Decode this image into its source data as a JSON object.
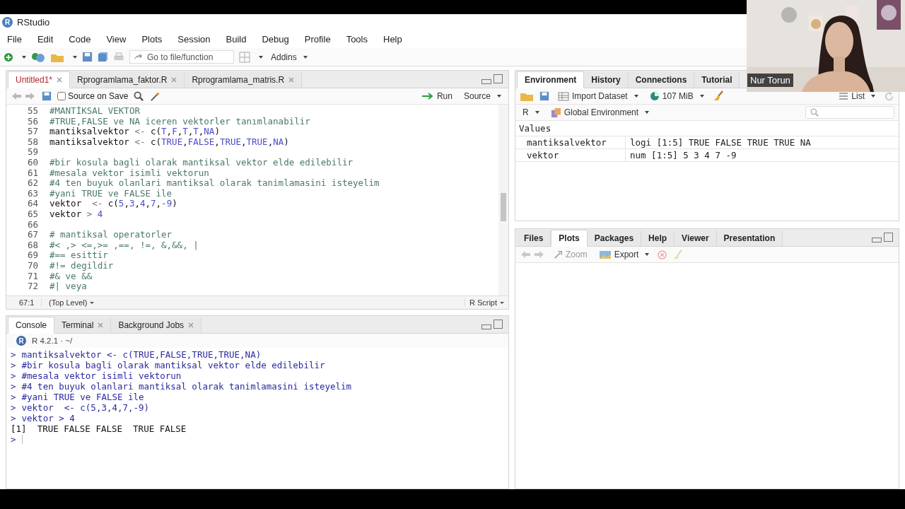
{
  "window": {
    "title": "RStudio",
    "logo": "R"
  },
  "menu": [
    "File",
    "Edit",
    "Code",
    "View",
    "Plots",
    "Session",
    "Build",
    "Debug",
    "Profile",
    "Tools",
    "Help"
  ],
  "toolbar": {
    "goto_placeholder": "Go to file/function",
    "addins": "Addins"
  },
  "source": {
    "tabs": [
      {
        "label": "Untitled1*",
        "selected": true,
        "modified": true
      },
      {
        "label": "Rprogramlama_faktor.R",
        "selected": false,
        "modified": false
      },
      {
        "label": "Rprogramlama_matris.R",
        "selected": false,
        "modified": false
      }
    ],
    "source_on_save": {
      "label": "Source on Save",
      "checked": false
    },
    "run": "Run",
    "source_button": "Source",
    "lines": [
      {
        "number": "55",
        "segments": [
          {
            "kind": "comment",
            "text": "#MANTİKSAL VEKTOR"
          }
        ]
      },
      {
        "number": "56",
        "segments": [
          {
            "kind": "comment",
            "text": "#TRUE,FALSE ve NA iceren vektorler tanımlanabilir"
          }
        ]
      },
      {
        "number": "57",
        "segments": [
          {
            "kind": "code",
            "text": "mantiksalvektor "
          },
          {
            "kind": "op",
            "text": "<-"
          },
          {
            "kind": "code",
            "text": " c("
          },
          {
            "kind": "const",
            "text": "T"
          },
          {
            "kind": "code",
            "text": ","
          },
          {
            "kind": "const",
            "text": "F"
          },
          {
            "kind": "code",
            "text": ","
          },
          {
            "kind": "const",
            "text": "T"
          },
          {
            "kind": "code",
            "text": ","
          },
          {
            "kind": "const",
            "text": "T"
          },
          {
            "kind": "code",
            "text": ","
          },
          {
            "kind": "const",
            "text": "NA"
          },
          {
            "kind": "code",
            "text": ")"
          }
        ]
      },
      {
        "number": "58",
        "segments": [
          {
            "kind": "code",
            "text": "mantiksalvektor "
          },
          {
            "kind": "op",
            "text": "<-"
          },
          {
            "kind": "code",
            "text": " c("
          },
          {
            "kind": "const",
            "text": "TRUE"
          },
          {
            "kind": "code",
            "text": ","
          },
          {
            "kind": "const",
            "text": "FALSE"
          },
          {
            "kind": "code",
            "text": ","
          },
          {
            "kind": "const",
            "text": "TRUE"
          },
          {
            "kind": "code",
            "text": ","
          },
          {
            "kind": "const",
            "text": "TRUE"
          },
          {
            "kind": "code",
            "text": ","
          },
          {
            "kind": "const",
            "text": "NA"
          },
          {
            "kind": "code",
            "text": ")"
          }
        ]
      },
      {
        "number": "59"
      },
      {
        "number": "60",
        "segments": [
          {
            "kind": "comment",
            "text": "#bir kosula bagli olarak mantiksal vektor elde edilebilir"
          }
        ]
      },
      {
        "number": "61",
        "segments": [
          {
            "kind": "comment",
            "text": "#mesala vektor isimli vektorun"
          }
        ]
      },
      {
        "number": "62",
        "segments": [
          {
            "kind": "comment",
            "text": "#4 ten buyuk olanlari mantiksal olarak tanimlamasini isteyelim"
          }
        ]
      },
      {
        "number": "63",
        "segments": [
          {
            "kind": "comment",
            "text": "#yani TRUE ve FALSE ile"
          }
        ]
      },
      {
        "number": "64",
        "segments": [
          {
            "kind": "code",
            "text": "vektor  "
          },
          {
            "kind": "op",
            "text": "<-"
          },
          {
            "kind": "code",
            "text": " c("
          },
          {
            "kind": "const",
            "text": "5"
          },
          {
            "kind": "code",
            "text": ","
          },
          {
            "kind": "const",
            "text": "3"
          },
          {
            "kind": "code",
            "text": ","
          },
          {
            "kind": "const",
            "text": "4"
          },
          {
            "kind": "code",
            "text": ","
          },
          {
            "kind": "const",
            "text": "7"
          },
          {
            "kind": "code",
            "text": ","
          },
          {
            "kind": "const",
            "text": "-9"
          },
          {
            "kind": "code",
            "text": ")"
          }
        ]
      },
      {
        "number": "65",
        "segments": [
          {
            "kind": "code",
            "text": "vektor "
          },
          {
            "kind": "op",
            "text": "> "
          },
          {
            "kind": "const",
            "text": "4"
          }
        ]
      },
      {
        "number": "66"
      },
      {
        "number": "67",
        "segments": [
          {
            "kind": "comment",
            "text": "# mantiksal operatorler"
          }
        ]
      },
      {
        "number": "68",
        "segments": [
          {
            "kind": "comment",
            "text": "#< ,> <=,>= ,==, !=, &,&&, |"
          }
        ]
      },
      {
        "number": "69",
        "segments": [
          {
            "kind": "comment",
            "text": "#== esittir"
          }
        ]
      },
      {
        "number": "70",
        "segments": [
          {
            "kind": "comment",
            "text": "#!= degildir"
          }
        ]
      },
      {
        "number": "71",
        "segments": [
          {
            "kind": "comment",
            "text": "#& ve &&"
          }
        ]
      },
      {
        "number": "72",
        "segments": [
          {
            "kind": "comment",
            "text": "#| veya"
          }
        ]
      }
    ],
    "status": {
      "position": "67:1",
      "scope": "(Top Level)",
      "file_type": "R Script"
    }
  },
  "console": {
    "tabs": [
      {
        "label": "Console",
        "selected": true,
        "closable": false
      },
      {
        "label": "Terminal",
        "selected": false,
        "closable": true
      },
      {
        "label": "Background Jobs",
        "selected": false,
        "closable": true
      }
    ],
    "logo": "R",
    "version": "R 4.2.1 · ~/",
    "lines": [
      {
        "kind": "input",
        "prompt": ">",
        "text": "mantiksalvektor <- c(TRUE,FALSE,TRUE,TRUE,NA)"
      },
      {
        "kind": "input",
        "prompt": ">",
        "text": "#bir kosula bagli olarak mantiksal vektor elde edilebilir"
      },
      {
        "kind": "input",
        "prompt": ">",
        "text": "#mesala vektor isimli vektorun"
      },
      {
        "kind": "input",
        "prompt": ">",
        "text": "#4 ten buyuk olanlari mantiksal olarak tanimlamasini isteyelim"
      },
      {
        "kind": "input",
        "prompt": ">",
        "text": "#yani TRUE ve FALSE ile"
      },
      {
        "kind": "input",
        "prompt": ">",
        "text": "vektor  <- c(5,3,4,7,-9)"
      },
      {
        "kind": "input",
        "prompt": ">",
        "text": "vektor > 4"
      },
      {
        "kind": "output",
        "text": "[1]  TRUE FALSE FALSE  TRUE FALSE"
      }
    ],
    "prompt": ">"
  },
  "environment": {
    "tabs": [
      {
        "label": "Environment",
        "selected": true
      },
      {
        "label": "History",
        "selected": false
      },
      {
        "label": "Connections",
        "selected": false
      },
      {
        "label": "Tutorial",
        "selected": false
      }
    ],
    "import": "Import Dataset",
    "memory": "107 MiB",
    "view": "List",
    "language": "R",
    "scope": "Global Environment",
    "section": "Values",
    "rows": [
      {
        "name": "mantiksalvektor",
        "value": "logi [1:5] TRUE FALSE TRUE TRUE NA"
      },
      {
        "name": "vektor",
        "value": "num [1:5] 5 3 4 7 -9"
      }
    ]
  },
  "files": {
    "tabs": [
      {
        "label": "Files",
        "selected": false
      },
      {
        "label": "Plots",
        "selected": true
      },
      {
        "label": "Packages",
        "selected": false
      },
      {
        "label": "Help",
        "selected": false
      },
      {
        "label": "Viewer",
        "selected": false
      },
      {
        "label": "Presentation",
        "selected": false
      }
    ],
    "zoom": {
      "label": "Zoom",
      "disabled": true
    },
    "export": {
      "label": "Export",
      "disabled": false
    }
  },
  "webcam": {
    "kind": "picture",
    "name": "Nur Torun"
  }
}
